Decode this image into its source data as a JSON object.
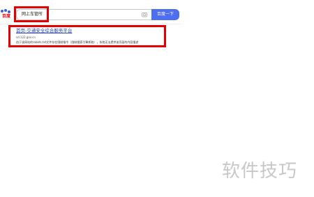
{
  "header": {
    "logo_text": "百度",
    "search_value": "网上车管所",
    "search_button_label": "百度一下"
  },
  "result": {
    "title": "首页-交通安全综合服务平台",
    "url": "sd.122.gov.cn",
    "snippet": "由于该网站的robots.txt文件存在限制指令（限制搜索引擎抓取），系统无法提供该页面的内容描述"
  },
  "watermark": "软件技巧",
  "colors": {
    "highlight": "#e30000",
    "brand_blue": "#4e6ef2",
    "link": "#2440b3"
  }
}
